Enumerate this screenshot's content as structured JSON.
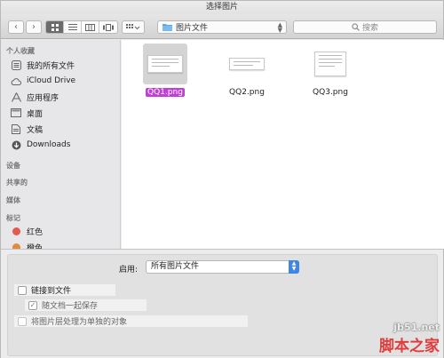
{
  "window": {
    "title": "选择图片"
  },
  "toolbar": {
    "back_label": "‹",
    "forward_label": "›",
    "path_label": "图片文件",
    "search_placeholder": "搜索"
  },
  "sidebar": {
    "sections": {
      "favorites": "个人收藏",
      "devices": "设备",
      "shared": "共享的",
      "media": "媒体",
      "tags": "标记"
    },
    "items": [
      {
        "label": "我的所有文件",
        "icon": "all-files-icon"
      },
      {
        "label": "iCloud Drive",
        "icon": "cloud-icon"
      },
      {
        "label": "应用程序",
        "icon": "applications-icon"
      },
      {
        "label": "桌面",
        "icon": "desktop-icon"
      },
      {
        "label": "文稿",
        "icon": "documents-icon"
      },
      {
        "label": "Downloads",
        "icon": "downloads-icon"
      }
    ],
    "tags": [
      {
        "label": "红色",
        "color": "#e05a4e"
      },
      {
        "label": "橙色",
        "color": "#e08a3a"
      }
    ]
  },
  "files": [
    {
      "name": "QQ1.png",
      "selected": true
    },
    {
      "name": "QQ2.png",
      "selected": false
    },
    {
      "name": "QQ3.png",
      "selected": false
    }
  ],
  "options": {
    "enable_label": "启用:",
    "enable_value": "所有图片文件",
    "link_to_file": "链接到文件",
    "save_with_document": "随文档一起保存",
    "separate_objects": "将图片层处理为单独的对象"
  },
  "watermark": {
    "site": "jb51.net",
    "brand": "脚本之家"
  },
  "colors": {
    "selection": "#c03fd6",
    "accent": "#3d86e8"
  }
}
